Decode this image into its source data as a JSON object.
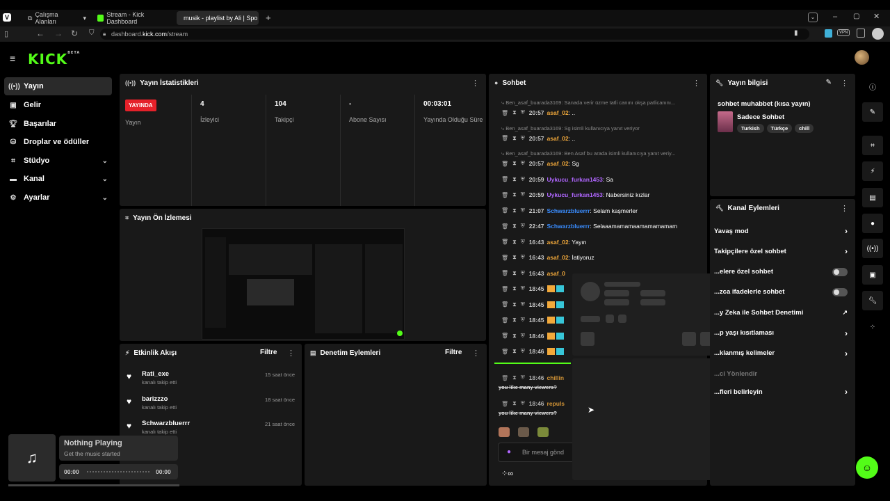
{
  "browser": {
    "tabs": [
      {
        "label": "Çalışma Alanları"
      },
      {
        "label": "Stream - Kick Dashboard"
      },
      {
        "label": "musik - playlist by Ali | Spo"
      }
    ],
    "url_prefix": "dashboard.",
    "url_domain": "kick.com",
    "url_path": "/stream",
    "vpn_label": "VPN"
  },
  "kick": {
    "logo": "KICK",
    "beta": "BETA"
  },
  "sidebar": {
    "items": [
      {
        "label": "Yayın",
        "icon": "broadcast-icon"
      },
      {
        "label": "Gelir",
        "icon": "revenue-icon"
      },
      {
        "label": "Başarılar",
        "icon": "trophy-icon"
      },
      {
        "label": "Droplar ve ödüller",
        "icon": "drops-icon"
      },
      {
        "label": "Stüdyo",
        "icon": "studio-icon"
      },
      {
        "label": "Kanal",
        "icon": "channel-icon"
      },
      {
        "label": "Ayarlar",
        "icon": "settings-icon"
      }
    ]
  },
  "stats": {
    "title": "Yayın İstatistikleri",
    "live_badge": "YAYINDA",
    "live_label": "Yayın",
    "items": [
      {
        "value": "4",
        "label": "İzleyici"
      },
      {
        "value": "104",
        "label": "Takipçi"
      },
      {
        "value": "-",
        "label": "Abone Sayısı"
      },
      {
        "value": "00:03:01",
        "label": "Yayında Olduğu Süre"
      }
    ]
  },
  "preview": {
    "title": "Yayın Ön İzlemesi"
  },
  "activity": {
    "title": "Etkinlik Akışı",
    "filter": "Filtre",
    "events": [
      {
        "name": "Rati_exe",
        "sub": "kanalı takip etti",
        "time": "15 saat önce"
      },
      {
        "name": "barizzzo",
        "sub": "kanalı takip etti",
        "time": "18 saat önce"
      },
      {
        "name": "Schwarzbluerrr",
        "sub": "kanalı takip etti",
        "time": "21 saat önce"
      }
    ]
  },
  "moderation": {
    "title": "Denetim Eylemleri",
    "filter": "Filtre"
  },
  "chat": {
    "title": "Sohbet",
    "lines": [
      {
        "reply": "Ben_asaf_buarada3169: Sanada verir üzme tatli canını okşa patlicanını...",
        "time": "20:57",
        "user": "asaf_02",
        "color": "#f2a93b",
        "msg": ": .."
      },
      {
        "reply": "Ben_asaf_buarada3169: Sg isimli kullanıcıya yanıt veriyor",
        "time": "20:57",
        "user": "asaf_02",
        "color": "#f2a93b",
        "msg": ": .."
      },
      {
        "reply": "Ben_asaf_buarada3169: Ben Asaf bu arada isimli kullanıcıya yanıt veriy...",
        "time": "20:57",
        "user": "asaf_02",
        "color": "#f2a93b",
        "msg": ": Sg"
      },
      {
        "reply": "",
        "time": "20:59",
        "user": "Uykucu_furkan1453",
        "color": "#b066ff",
        "msg": ": Sa"
      },
      {
        "reply": "",
        "time": "20:59",
        "user": "Uykucu_furkan1453",
        "color": "#b066ff",
        "msg": ": Nabersiniz kızlar"
      },
      {
        "reply": "",
        "time": "21:07",
        "user": "Schwarzbluerrr",
        "color": "#3a8dff",
        "msg": ": Selam kaşmerler"
      },
      {
        "reply": "",
        "time": "22:47",
        "user": "Schwarzbluerrr",
        "color": "#3a8dff",
        "msg": ": Selaaamamamaamamamamam"
      },
      {
        "reply": "",
        "time": "16:43",
        "user": "asaf_02",
        "color": "#f2a93b",
        "msg": ": Yayın"
      },
      {
        "reply": "",
        "time": "16:43",
        "user": "asaf_02",
        "color": "#f2a93b",
        "msg": ": İatiyoruz"
      },
      {
        "reply": "",
        "time": "16:43",
        "user": "asaf_0",
        "color": "#f2a93b",
        "msg": ""
      }
    ],
    "badge_times": [
      "18:45",
      "18:45",
      "18:45",
      "18:46",
      "18:46"
    ],
    "late": [
      {
        "time": "18:46",
        "user": "chillin",
        "msg": "you like many viewers?"
      },
      {
        "time": "18:46",
        "user": "repuls",
        "msg": "you like many viewers?"
      }
    ],
    "input_placeholder": "Bir mesaj gönd"
  },
  "info": {
    "title": "Yayın bilgisi",
    "stream_title": "sohbet muhabbet (kısa yayın)",
    "category": "Sadece Sohbet",
    "tags": [
      "Turkish",
      "Türkçe",
      "chill"
    ]
  },
  "actions": {
    "title": "Kanal Eylemleri",
    "items": [
      {
        "label": "Yavaş mod",
        "kind": "chevron"
      },
      {
        "label": "Takipçilere özel sohbet",
        "kind": "chevron"
      },
      {
        "label": "...elere özel sohbet",
        "kind": "toggle"
      },
      {
        "label": "...zca ifadelerle sohbet",
        "kind": "toggle"
      },
      {
        "label": "...y Zeka ile Sohbet Denetimi",
        "kind": "external"
      },
      {
        "label": "...p yaşı kısıtlaması",
        "kind": "chevron"
      },
      {
        "label": "...klanmış kelimeler",
        "kind": "chevron"
      },
      {
        "label": "...ci Yönlendir",
        "kind": "muted"
      },
      {
        "label": "...fleri belirleyin",
        "kind": "chevron"
      }
    ]
  },
  "music": {
    "title": "Nothing Playing",
    "subtitle": "Get the music started",
    "time_start": "00:00",
    "time_end": "00:00"
  }
}
